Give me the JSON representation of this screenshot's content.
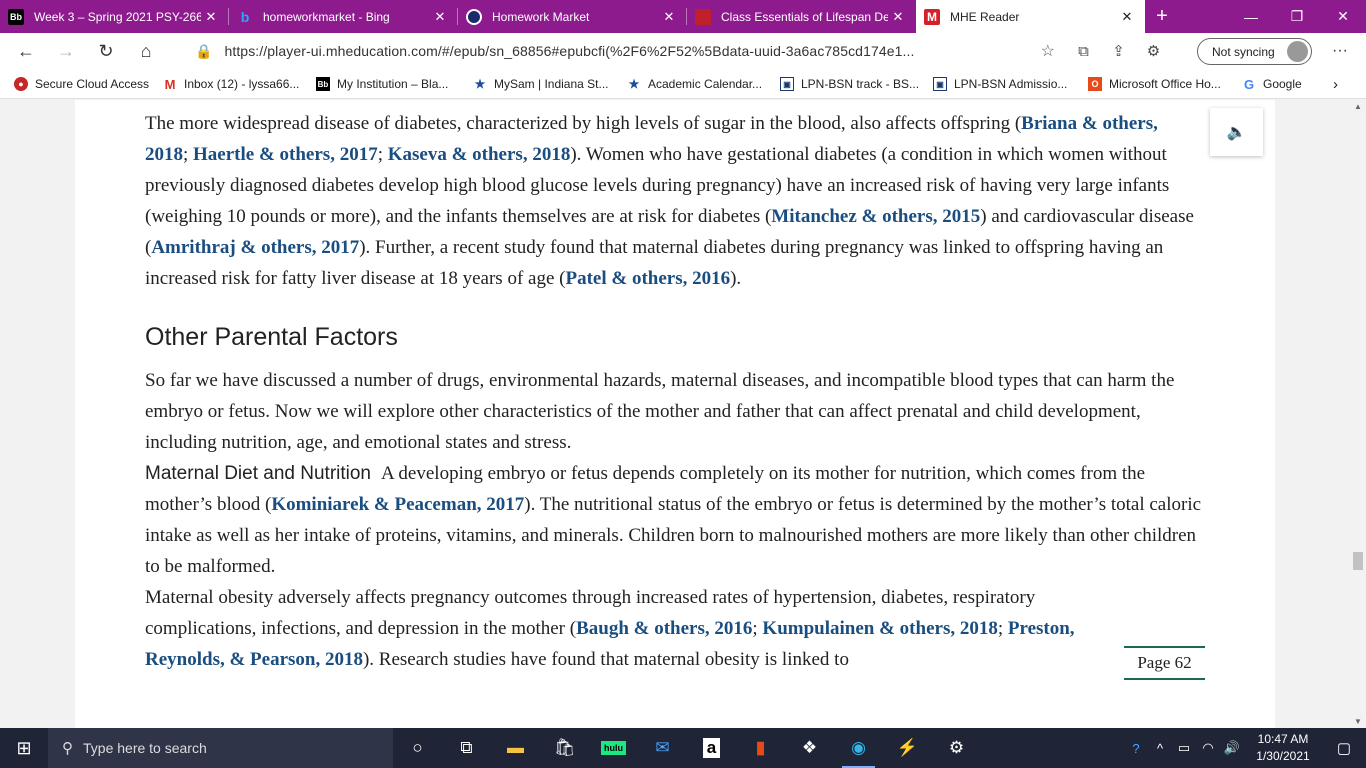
{
  "tabs": [
    {
      "favicon": "Bb",
      "title": "Week 3 – Spring 2021 PSY-266",
      "active": false
    },
    {
      "favicon": "b",
      "title": "homeworkmarket - Bing",
      "active": false
    },
    {
      "favicon": "hm",
      "title": "Homework Market",
      "active": false
    },
    {
      "favicon": "cl",
      "title": "Class Essentials of Lifespan De",
      "active": false
    },
    {
      "favicon": "M",
      "title": "MHE Reader",
      "active": true
    }
  ],
  "new_tab_label": "+",
  "address": {
    "url": "https://player-ui.mheducation.com/#/epub/sn_68856#epubcfi(%2F6%2F52%5Bdata-uuid-3a6ac785cd174e1...",
    "sync_label": "Not syncing"
  },
  "favorites": [
    {
      "label": "Secure Cloud Access"
    },
    {
      "label": "Inbox (12) - lyssa66..."
    },
    {
      "label": "My Institution – Bla..."
    },
    {
      "label": "MySam | Indiana St..."
    },
    {
      "label": "Academic Calendar..."
    },
    {
      "label": "LPN-BSN track - BS..."
    },
    {
      "label": "LPN-BSN Admissio..."
    },
    {
      "label": "Microsoft Office Ho..."
    },
    {
      "label": "Google"
    }
  ],
  "content": {
    "p1": {
      "t1": "The more widespread disease of diabetes, characterized by high levels of sugar in the blood, also affects offspring (",
      "c1": "Briana & others, 2018",
      "t2": "; ",
      "c2": "Haertle & others, 2017",
      "t3": "; ",
      "c3": "Kaseva & others, 2018",
      "t4": "). Women who have gestational diabetes (a condition in which women without previously diagnosed diabetes develop high blood glucose levels during pregnancy) have an increased risk of having very large infants (weighing 10 pounds or more), and the infants themselves are at risk for diabetes (",
      "c4": "Mitanchez & others, 2015",
      "t5": ") and cardiovascular disease (",
      "c5": "Amrithraj & others, 2017",
      "t6": "). Further, a recent study found that maternal diabetes during pregnancy was linked to offspring having an increased risk for fatty liver disease at 18 years of age (",
      "c6": "Patel & others, 2016",
      "t7": ")."
    },
    "heading": "Other Parental Factors",
    "p2": "So far we have discussed a number of drugs, environmental hazards, maternal diseases, and incompatible blood types that can harm the embryo or fetus. Now we will explore other characteristics of the mother and father that can affect prenatal and child development, including nutrition, age, and emotional states and stress.",
    "p3": {
      "runin": "Maternal Diet and Nutrition",
      "t1": "A developing embryo or fetus depends completely on its mother for nutrition, which comes from the mother’s blood (",
      "c1": "Kominiarek & Peaceman, 2017",
      "t2": "). The nutritional status of the embryo or fetus is determined by the mother’s total caloric intake as well as her intake of proteins, vitamins, and minerals. Children born to malnourished mothers are more likely than other children to be malformed."
    },
    "p4": {
      "t1": "Maternal obesity adversely affects pregnancy outcomes through increased rates of hypertension, diabetes, respiratory complications, infections, and depression in the mother (",
      "c1": "Baugh & others, 2016",
      "t2": "; ",
      "c2": "Kumpulainen & others, 2018",
      "t3": "; ",
      "c3": "Preston, Reynolds, & Pearson, 2018",
      "t4": "). Research studies have found that maternal obesity is linked to"
    },
    "page_label": "Page 62"
  },
  "taskbar": {
    "search_placeholder": "Type here to search",
    "time": "10:47 AM",
    "date": "1/30/2021"
  },
  "colors": {
    "tabbar": "#8e1b8e",
    "citation": "#1a4d80",
    "page_rule": "#1a6b4a"
  }
}
